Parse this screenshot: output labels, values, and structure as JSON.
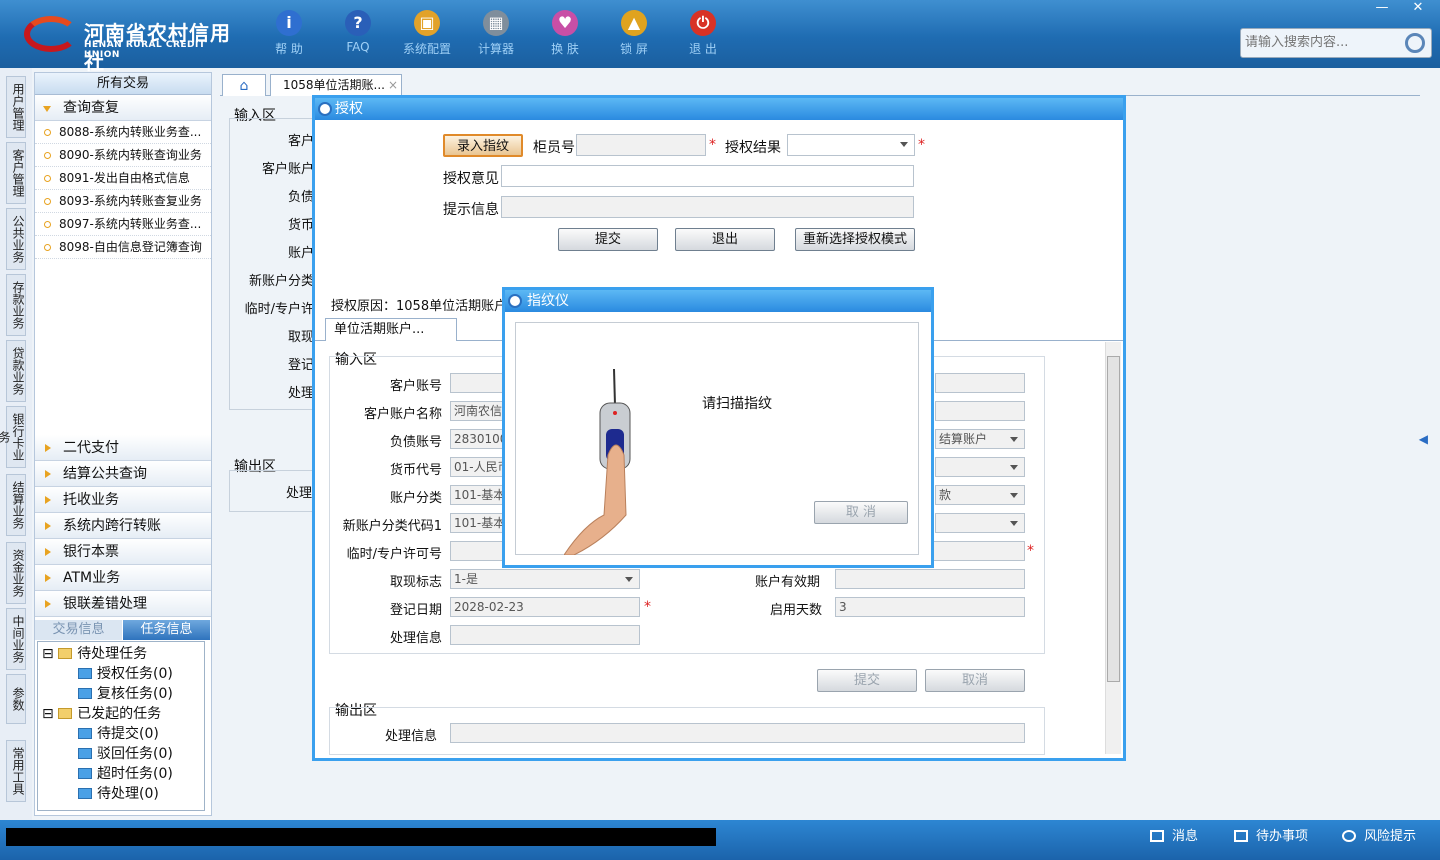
{
  "app": {
    "name_cn": "河南省农村信用社",
    "name_en": "HENAN RURAL CREDIT UNION"
  },
  "toolbar": [
    {
      "label": "帮 助",
      "icon": "info-icon",
      "glyph": "i",
      "color": "#2f6fd0"
    },
    {
      "label": "FAQ",
      "icon": "help-icon",
      "glyph": "?",
      "color": "#2a5fb8"
    },
    {
      "label": "系统配置",
      "icon": "config-icon",
      "glyph": "▣",
      "color": "#e2a22a"
    },
    {
      "label": "计算器",
      "icon": "calculator-icon",
      "glyph": "▦",
      "color": "#7f8e9c"
    },
    {
      "label": "换 肤",
      "icon": "skin-icon",
      "glyph": "♥",
      "color": "#c84fa6"
    },
    {
      "label": "锁 屏",
      "icon": "lock-icon",
      "glyph": "▲",
      "color": "#e0a31f"
    },
    {
      "label": "退 出",
      "icon": "power-icon",
      "glyph": "⏻",
      "color": "#d83226"
    }
  ],
  "window": {
    "minimize": "—",
    "close": "✕"
  },
  "search": {
    "placeholder": "请输入搜索内容..."
  },
  "vtabs": [
    "用户管理",
    "客户管理",
    "公共业务",
    "存款业务",
    "贷款业务",
    "银行卡业务",
    "结算业务",
    "资金业务",
    "中间业务",
    "参数",
    "常用工具"
  ],
  "nav": {
    "header": "所有交易",
    "open_group": "查询查复",
    "items": [
      "8088-系统内转账业务查...",
      "8090-系统内转账查询业务",
      "8091-发出自由格式信息",
      "8093-系统内转账查复业务",
      "8097-系统内转账业务查...",
      "8098-自由信息登记簿查询"
    ],
    "groups": [
      "二代支付",
      "结算公共查询",
      "托收业务",
      "系统内跨行转账",
      "银行本票",
      "ATM业务",
      "银联差错处理"
    ],
    "task_tabs": [
      "交易信息",
      "任务信息"
    ],
    "tree": [
      "待处理任务",
      "授权任务(0)",
      "复核任务(0)",
      "已发起的任务",
      "待提交(0)",
      "驳回任务(0)",
      "超时任务(0)",
      "待处理(0)"
    ]
  },
  "tabs": {
    "home": "⌂",
    "doc": "1058单位活期账...",
    "doc_close": "×"
  },
  "bg": {
    "input_area": "输入区",
    "output_area": "输出区",
    "labels": [
      "客户",
      "客户账户",
      "负债",
      "货币",
      "账户",
      "新账户分类",
      "临时/专户许",
      "取现",
      "登记",
      "处理"
    ],
    "out_label": "处理"
  },
  "auth": {
    "title": "授权",
    "fp_button": "录入指纹",
    "teller_label": "柜员号",
    "result_label": "授权结果",
    "opinion_label": "授权意见",
    "hint_label": "提示信息",
    "submit": "提交",
    "exit": "退出",
    "reselect": "重新选择授权模式",
    "reason": "授权原因：1058单位活期账户",
    "subtab": "单位活期账户..."
  },
  "form": {
    "input_area": "输入区",
    "output_area": "输出区",
    "left": [
      {
        "label": "客户账号",
        "value": ""
      },
      {
        "label": "客户账户名称",
        "value": "河南农信"
      },
      {
        "label": "负债账号",
        "value": "28301001"
      },
      {
        "label": "货币代号",
        "value": "01-人民币"
      },
      {
        "label": "账户分类",
        "value": "101-基本"
      },
      {
        "label": "新账户分类代码1",
        "value": "101-基本"
      },
      {
        "label": "临时/专户许可号",
        "value": ""
      },
      {
        "label": "取现标志",
        "value": "1-是"
      },
      {
        "label": "登记日期",
        "value": "2028-02-23"
      },
      {
        "label": "处理信息",
        "value": ""
      }
    ],
    "right_selects": [
      "结算账户",
      "",
      "款",
      ""
    ],
    "acct_valid_label": "账户有效期",
    "days_label": "启用天数",
    "days_value": "3",
    "submit": "提交",
    "cancel": "取消",
    "out_label": "处理信息"
  },
  "fp": {
    "title": "指纹仪",
    "prompt": "请扫描指纹",
    "cancel": "取 消"
  },
  "status": {
    "messages": "消息",
    "todo": "待办事项",
    "risk": "风险提示"
  }
}
